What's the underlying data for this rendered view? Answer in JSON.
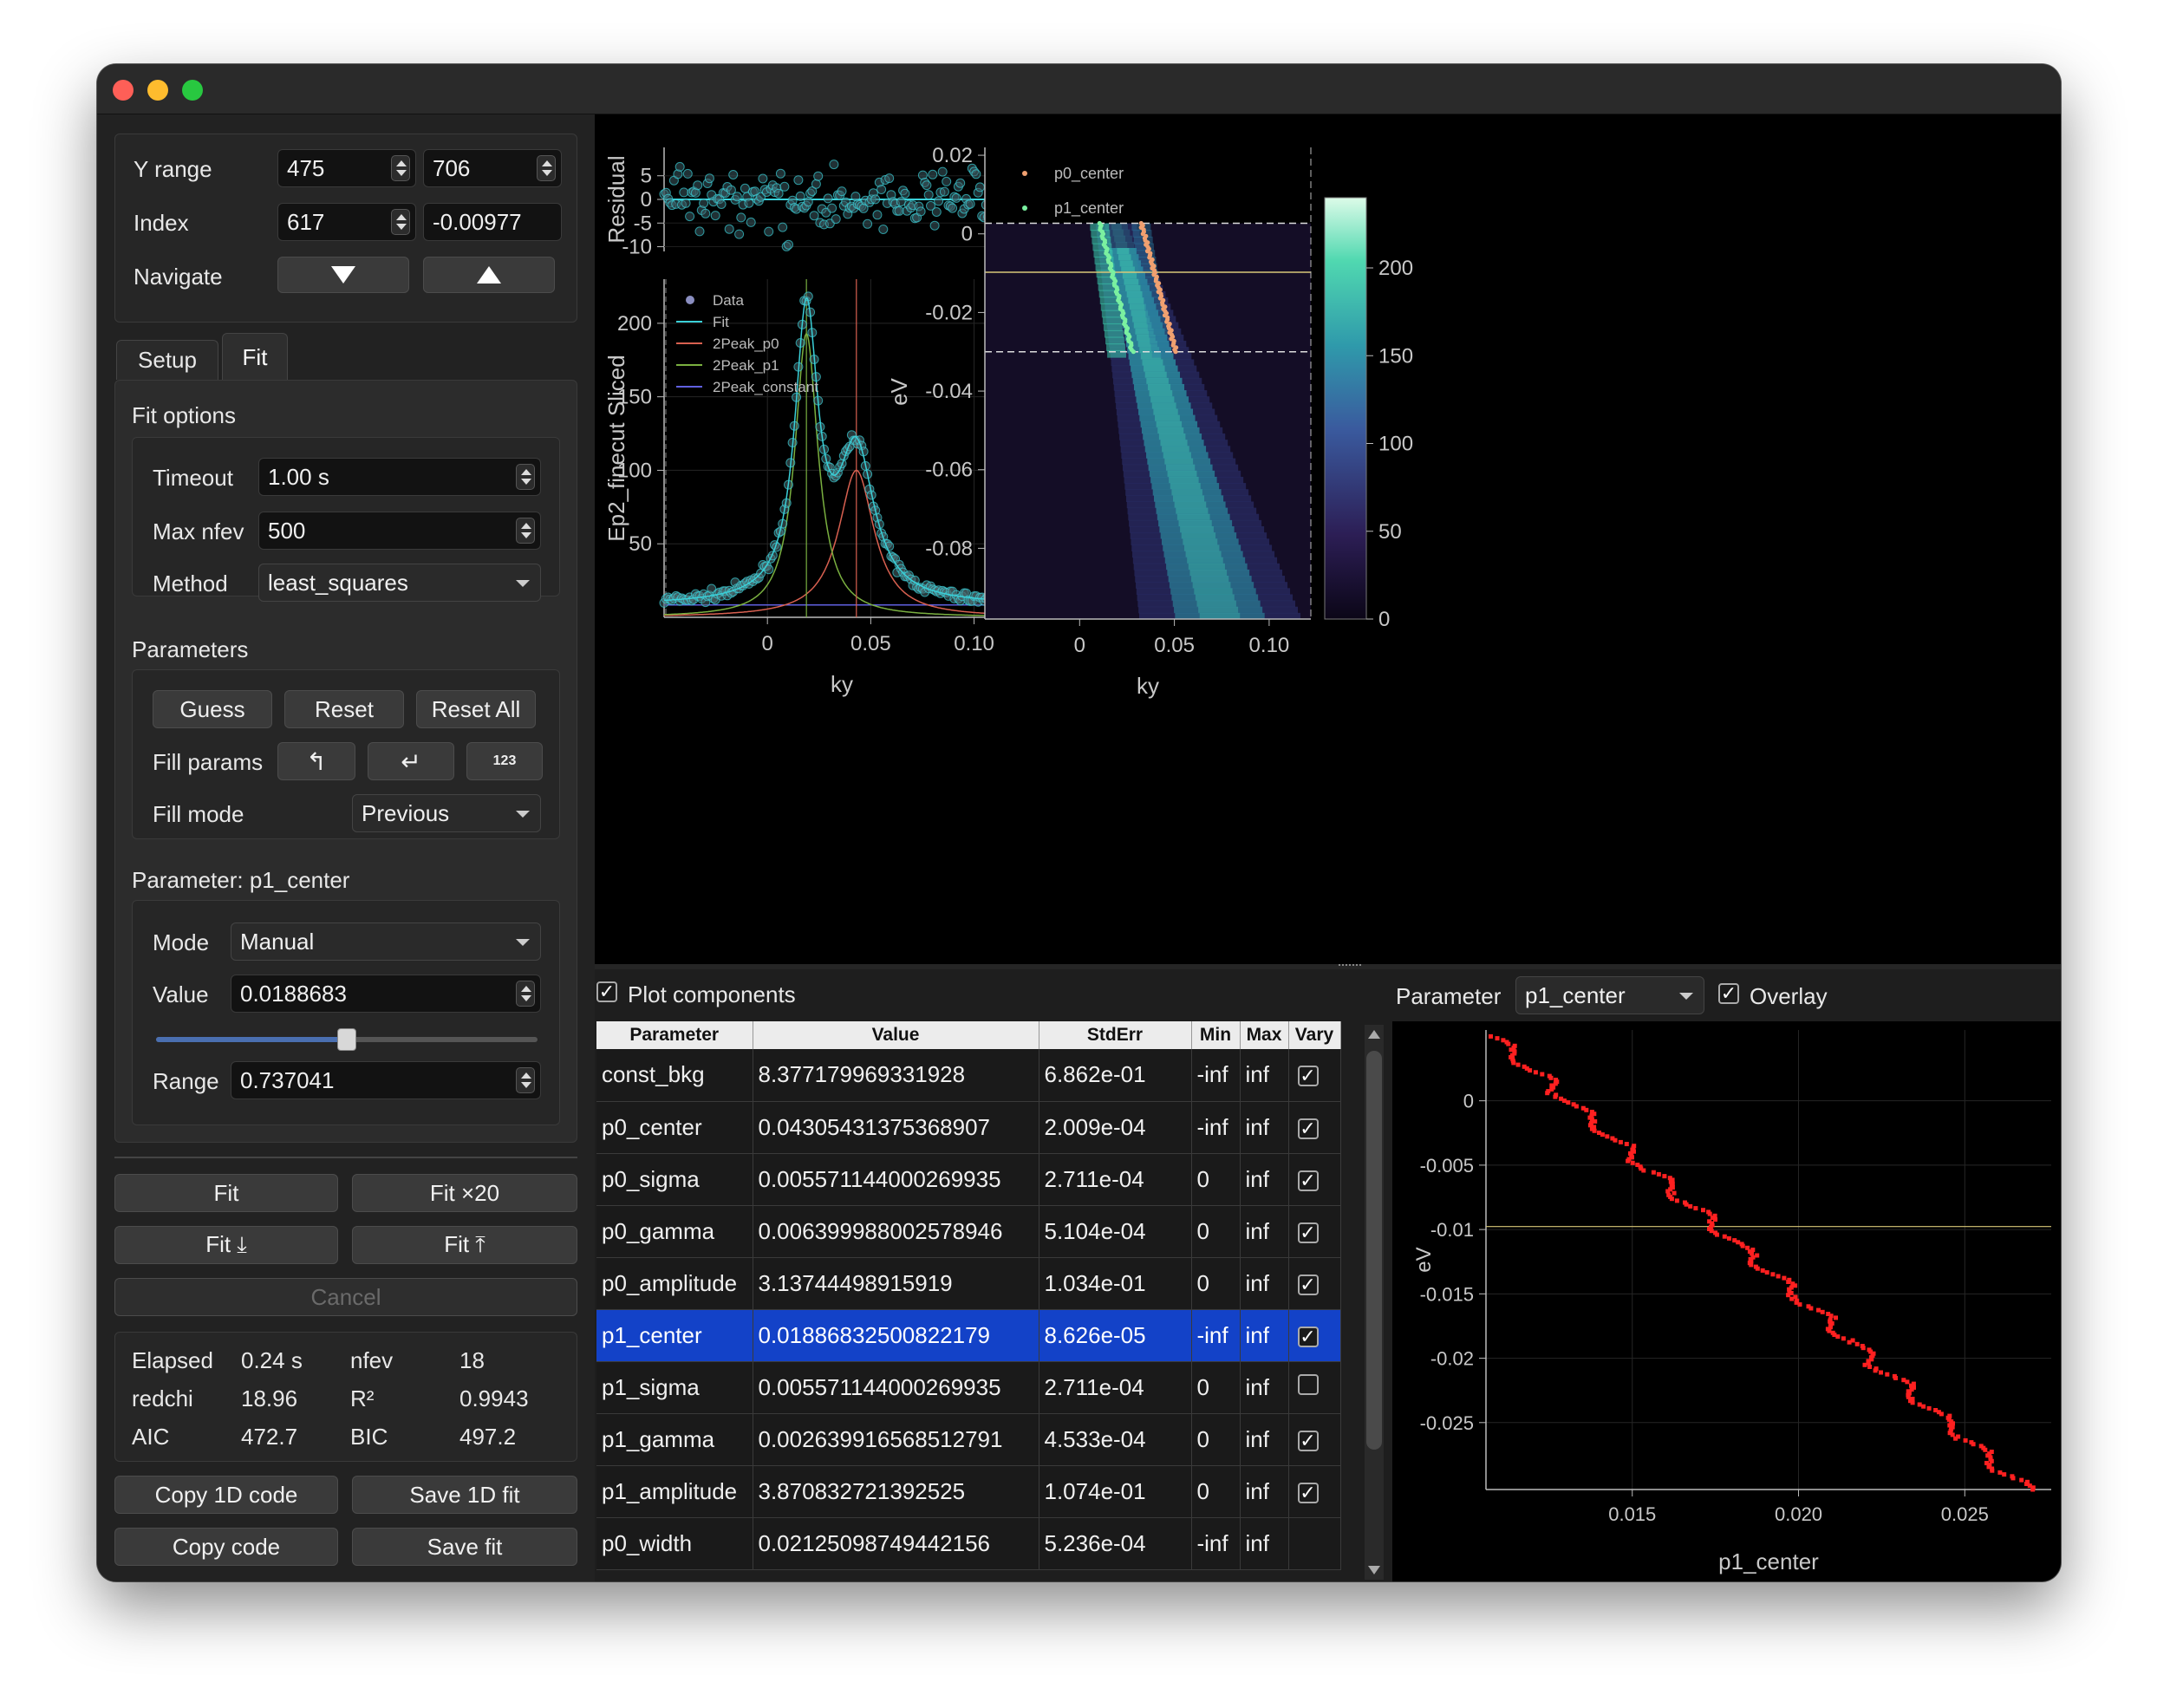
{
  "left_panel": {
    "yrange": {
      "label": "Y range",
      "min": "475",
      "max": "706"
    },
    "index": {
      "label": "Index",
      "value": "617",
      "coord": "-0.00977"
    },
    "navigate": {
      "label": "Navigate"
    },
    "tabs": [
      {
        "label": "Setup"
      },
      {
        "label": "Fit"
      }
    ],
    "fit_options": {
      "title": "Fit options",
      "timeout_label": "Timeout",
      "timeout": "1.00 s",
      "maxnfev_label": "Max nfev",
      "maxnfev": "500",
      "method_label": "Method",
      "method": "least_squares"
    },
    "parameters": {
      "title": "Parameters",
      "guess": "Guess",
      "reset": "Reset",
      "reset_all": "Reset All",
      "fill_params_label": "Fill params",
      "fill_mode_label": "Fill mode",
      "fill_mode": "Previous"
    },
    "param_editor": {
      "title": "Parameter: p1_center",
      "mode_label": "Mode",
      "mode": "Manual",
      "value_label": "Value",
      "value": "0.0188683",
      "slider_fraction": 0.5,
      "range_label": "Range",
      "range": "0.737041"
    },
    "actions": {
      "fit": "Fit",
      "fit20": "Fit ×20",
      "fit_down": "Fit ⤓",
      "fit_up": "Fit ⤒",
      "cancel": "Cancel"
    },
    "stats": {
      "elapsed_label": "Elapsed",
      "elapsed": "0.24 s",
      "nfev_label": "nfev",
      "nfev": "18",
      "redchi_label": "redchi",
      "redchi": "18.96",
      "r2_label": "R²",
      "r2": "0.9943",
      "aic_label": "AIC",
      "aic": "472.7",
      "bic_label": "BIC",
      "bic": "497.2"
    },
    "copy": {
      "copy1d": "Copy 1D code",
      "save1d": "Save 1D fit",
      "copy": "Copy code",
      "save": "Save fit"
    }
  },
  "lower": {
    "plot_components": "Plot components",
    "parameter_label": "Parameter",
    "parameter_value": "p1_center",
    "overlay": "Overlay"
  },
  "table": {
    "headers": [
      "Parameter",
      "Value",
      "StdErr",
      "Min",
      "Max",
      "Vary"
    ],
    "rows": [
      {
        "name": "const_bkg",
        "value": "8.377179969331928",
        "stderr": "6.862e-01",
        "min": "-inf",
        "max": "inf",
        "vary": true
      },
      {
        "name": "p0_center",
        "value": "0.04305431375368907",
        "stderr": "2.009e-04",
        "min": "-inf",
        "max": "inf",
        "vary": true
      },
      {
        "name": "p0_sigma",
        "value": "0.005571144000269935",
        "stderr": "2.711e-04",
        "min": "0",
        "max": "inf",
        "vary": true
      },
      {
        "name": "p0_gamma",
        "value": "0.006399988002578946",
        "stderr": "5.104e-04",
        "min": "0",
        "max": "inf",
        "vary": true
      },
      {
        "name": "p0_amplitude",
        "value": "3.13744498915919",
        "stderr": "1.034e-01",
        "min": "0",
        "max": "inf",
        "vary": true
      },
      {
        "name": "p1_center",
        "value": "0.01886832500822179",
        "stderr": "8.626e-05",
        "min": "-inf",
        "max": "inf",
        "vary": true
      },
      {
        "name": "p1_sigma",
        "value": "0.005571144000269935",
        "stderr": "2.711e-04",
        "min": "0",
        "max": "inf",
        "vary": false
      },
      {
        "name": "p1_gamma",
        "value": "0.002639916568512791",
        "stderr": "4.533e-04",
        "min": "0",
        "max": "inf",
        "vary": true
      },
      {
        "name": "p1_amplitude",
        "value": "3.870832721392525",
        "stderr": "1.074e-01",
        "min": "0",
        "max": "inf",
        "vary": true
      },
      {
        "name": "p0_width",
        "value": "0.02125098749442156",
        "stderr": "5.236e-04",
        "min": "-inf",
        "max": "inf",
        "vary": null
      }
    ]
  },
  "chart_data": [
    {
      "type": "scatter",
      "ylabel": "Residual",
      "xlim": [
        -0.05,
        0.122
      ],
      "ylim": [
        -11,
        11
      ],
      "yticks": [
        "5",
        "0",
        "-5",
        "-10"
      ],
      "series": [
        {
          "name": "Residual",
          "style": "markers"
        }
      ]
    },
    {
      "type": "line",
      "xlabel": "ky",
      "ylabel": "Ep2_finecut Sliced",
      "xlim": [
        -0.05,
        0.122
      ],
      "ylim": [
        0,
        230
      ],
      "xticks": [
        "0",
        "0.05",
        "0.10"
      ],
      "yticks": [
        "200",
        "150",
        "100",
        "50"
      ],
      "legend": "top-left",
      "series": [
        {
          "name": "Data",
          "color": "#8a8ec0"
        },
        {
          "name": "Fit",
          "color": "#3ad0d8"
        },
        {
          "name": "2Peak_p0",
          "color": "#d86050"
        },
        {
          "name": "2Peak_p1",
          "color": "#7ab040"
        },
        {
          "name": "2Peak_constant",
          "color": "#6060e0"
        }
      ],
      "params": {
        "const": 8.4,
        "p0_center": 0.04305,
        "p0_amp": 100,
        "p0_w": 0.0105,
        "p1_center": 0.01887,
        "p1_amp": 193,
        "p1_w": 0.0068
      }
    },
    {
      "type": "heatmap",
      "xlabel": "ky",
      "ylabel": "eV",
      "xlim": [
        -0.05,
        0.122
      ],
      "ylim": [
        -0.098,
        0.022
      ],
      "xticks": [
        "0",
        "0.05",
        "0.10"
      ],
      "yticks": [
        "0.02",
        "0",
        "-0.02",
        "-0.04",
        "-0.06",
        "-0.08"
      ],
      "colorbar_ticks": [
        "200",
        "150",
        "100",
        "50",
        "0"
      ],
      "legend": "top-left",
      "series": [
        {
          "name": "p0_center",
          "color": "#f0a070"
        },
        {
          "name": "p1_center",
          "color": "#7af0a0"
        }
      ],
      "index_line": -0.00977,
      "yrange_lines": [
        0.0027,
        -0.03
      ]
    },
    {
      "type": "scatter",
      "xlabel": "p1_center",
      "ylabel": "eV",
      "xlim": [
        0.0106,
        0.0276
      ],
      "ylim": [
        -0.0302,
        0.0055
      ],
      "xticks": [
        "0.015",
        "0.020",
        "0.025"
      ],
      "yticks": [
        "0",
        "-0.005",
        "-0.01",
        "-0.015",
        "-0.02",
        "-0.025"
      ],
      "color": "#ff2020",
      "index_line": -0.00977
    }
  ]
}
